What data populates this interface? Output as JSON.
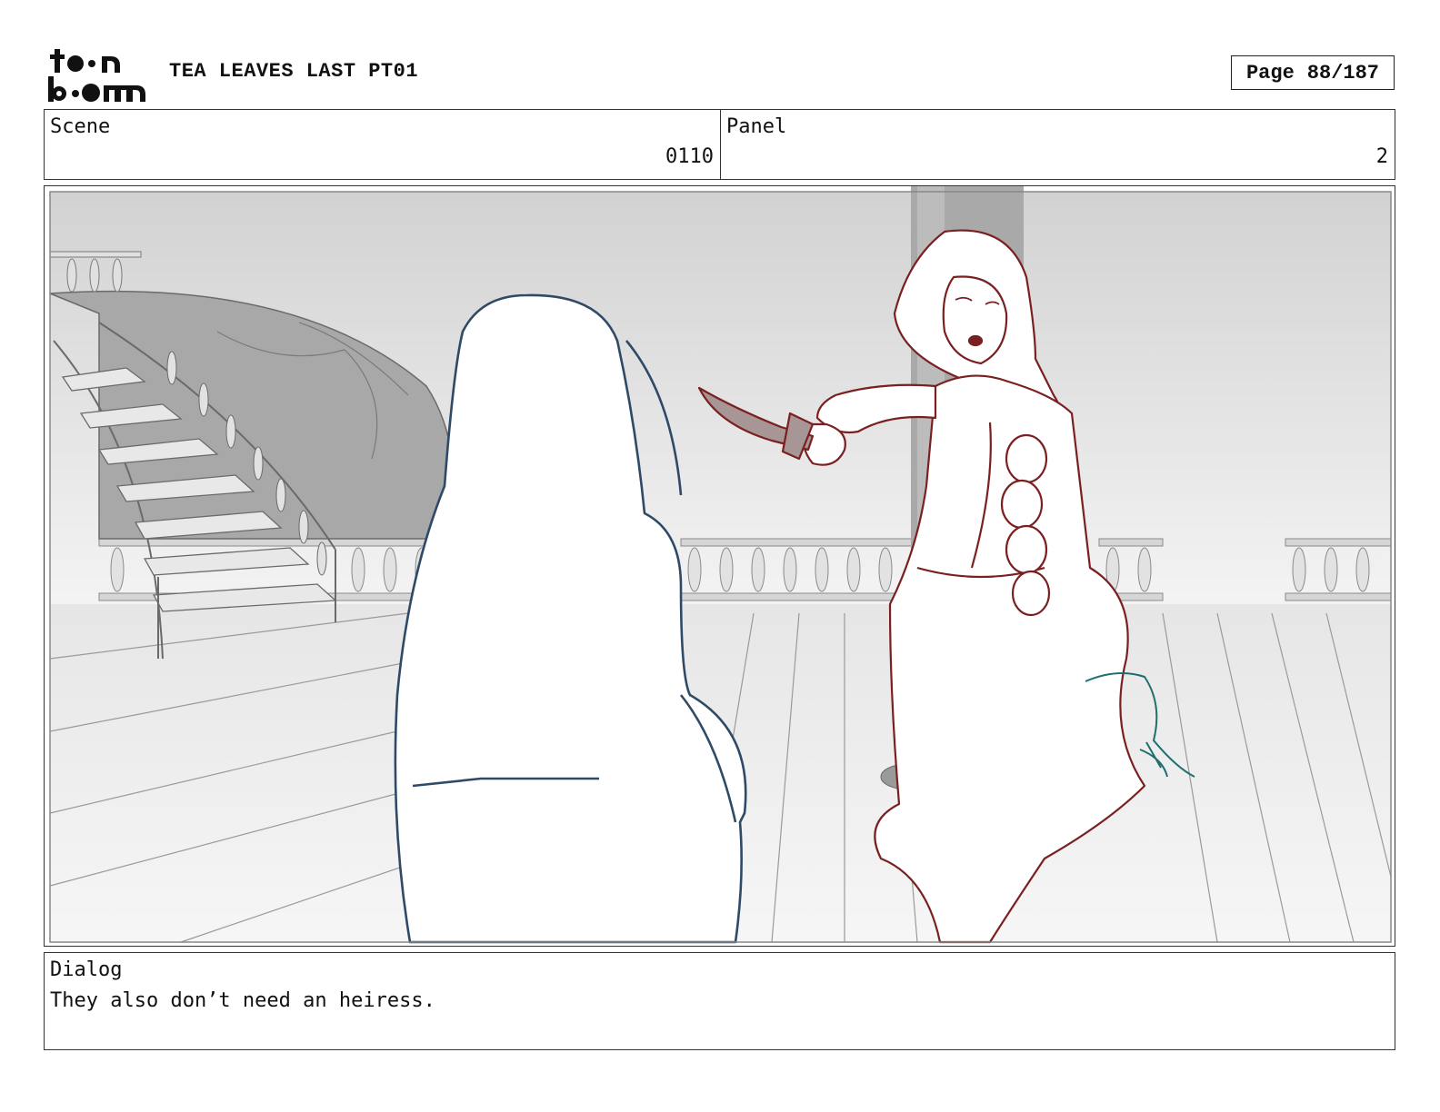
{
  "header": {
    "logo_text": "toon boom",
    "project_title": "TEA LEAVES LAST PT01",
    "page_label": "Page",
    "page_value": "88/187"
  },
  "info": {
    "scene_label": "Scene",
    "scene_value": "0110",
    "panel_label": "Panel",
    "panel_value": "2"
  },
  "dialog": {
    "label": "Dialog",
    "text": "They also don’t need an heiress."
  }
}
